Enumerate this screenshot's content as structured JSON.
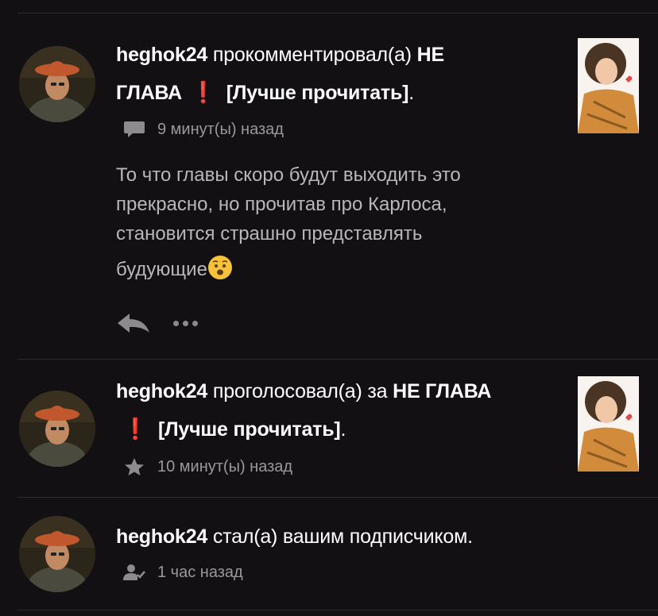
{
  "notifications": [
    {
      "username": "heghok24",
      "action": "прокомментировал(а)",
      "title_part1": "НЕ",
      "title_part2": "ГЛАВА",
      "exclamation": "❗",
      "subtitle": "[Лучше прочитать]",
      "period": ".",
      "time": "9 минут(ы) назад",
      "icon": "comment-icon",
      "comment_line1": "То что главы скоро будут выходить это",
      "comment_line2": "прекрасно, но прочитав про Карлоса,",
      "comment_line3": "становится страшно представлять",
      "comment_line4": "будующие"
    },
    {
      "username": "heghok24",
      "action": "проголосовал(а) за",
      "title": "НЕ ГЛАВА",
      "exclamation": "❗",
      "subtitle": "[Лучше прочитать]",
      "period": ".",
      "time": "10 минут(ы) назад",
      "icon": "star-icon"
    },
    {
      "username": "heghok24",
      "action": "стал(а) вашим подписчиком.",
      "time": "1 час назад",
      "icon": "user-check-icon"
    }
  ],
  "colors": {
    "background": "#121013",
    "accent_exclamation": "#e2261c",
    "meta_text": "#9b989c"
  }
}
